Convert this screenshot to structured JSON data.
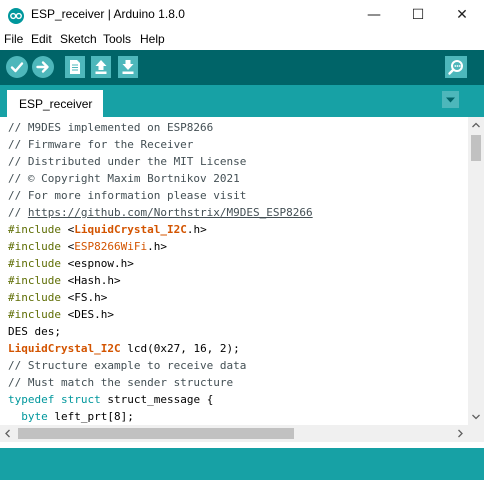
{
  "window": {
    "title": "ESP_receiver | Arduino 1.8.0",
    "controls": {
      "minimize": "—",
      "maximize": "☐",
      "close": "✕"
    }
  },
  "menu": {
    "items": [
      "File",
      "Edit",
      "Sketch",
      "Tools",
      "Help"
    ]
  },
  "toolbar": {
    "buttons": [
      "verify-icon",
      "upload-icon",
      "new-icon",
      "open-icon",
      "save-icon",
      "serial-monitor-icon"
    ]
  },
  "tabs": {
    "active": "ESP_receiver",
    "menu_icon": "tab-menu-icon"
  },
  "colors": {
    "toolbar_bg": "#006468",
    "tab_bar_bg": "#17a1a5",
    "button_bg": "#4db7bb",
    "comment": "#434f54",
    "preprocessor": "#5e6d03",
    "class_name": "#d35400",
    "keyword_type": "#00979c"
  },
  "code": {
    "lines": [
      "// M9DES implemented on ESP8266",
      "// Firmware for the Receiver",
      "// Distributed under the MIT License",
      "// © Copyright Maxim Bortnikov 2021",
      "// For more information please visit",
      "// https://github.com/Northstrix/M9DES_ESP8266",
      "#include <LiquidCrystal_I2C.h>",
      "#include <ESP8266WiFi.h>",
      "#include <espnow.h>",
      "#include <Hash.h>",
      "#include <FS.h>",
      "#include <DES.h>",
      "DES des;",
      "LiquidCrystal_I2C lcd(0x27, 16, 2);",
      "// Structure example to receive data",
      "// Must match the sender structure",
      "typedef struct struct_message {",
      "  byte left_prt[8];"
    ],
    "tokens": {
      "url_prefix": "// ",
      "url": "https://github.com/Northstrix/M9DES_ESP8266",
      "include": "#include",
      "lt": " <",
      "lib1": "LiquidCrystal_I2C",
      "lib1_tail": ".h>",
      "lib2": "ESP8266WiFi",
      "lib2_tail": ".h>",
      "inc3": "espnow.h>",
      "inc4": "Hash.h>",
      "inc5": "FS.h>",
      "inc6": "DES.h>",
      "lcd_class": "LiquidCrystal_I2C",
      "lcd_rest": " lcd(0x27, 16, 2);",
      "typedef": "typedef",
      "struct": "struct",
      "struct_rest": " struct_message {",
      "indent": "  ",
      "byte": "byte",
      "byte_rest": " left_prt[8];"
    }
  }
}
